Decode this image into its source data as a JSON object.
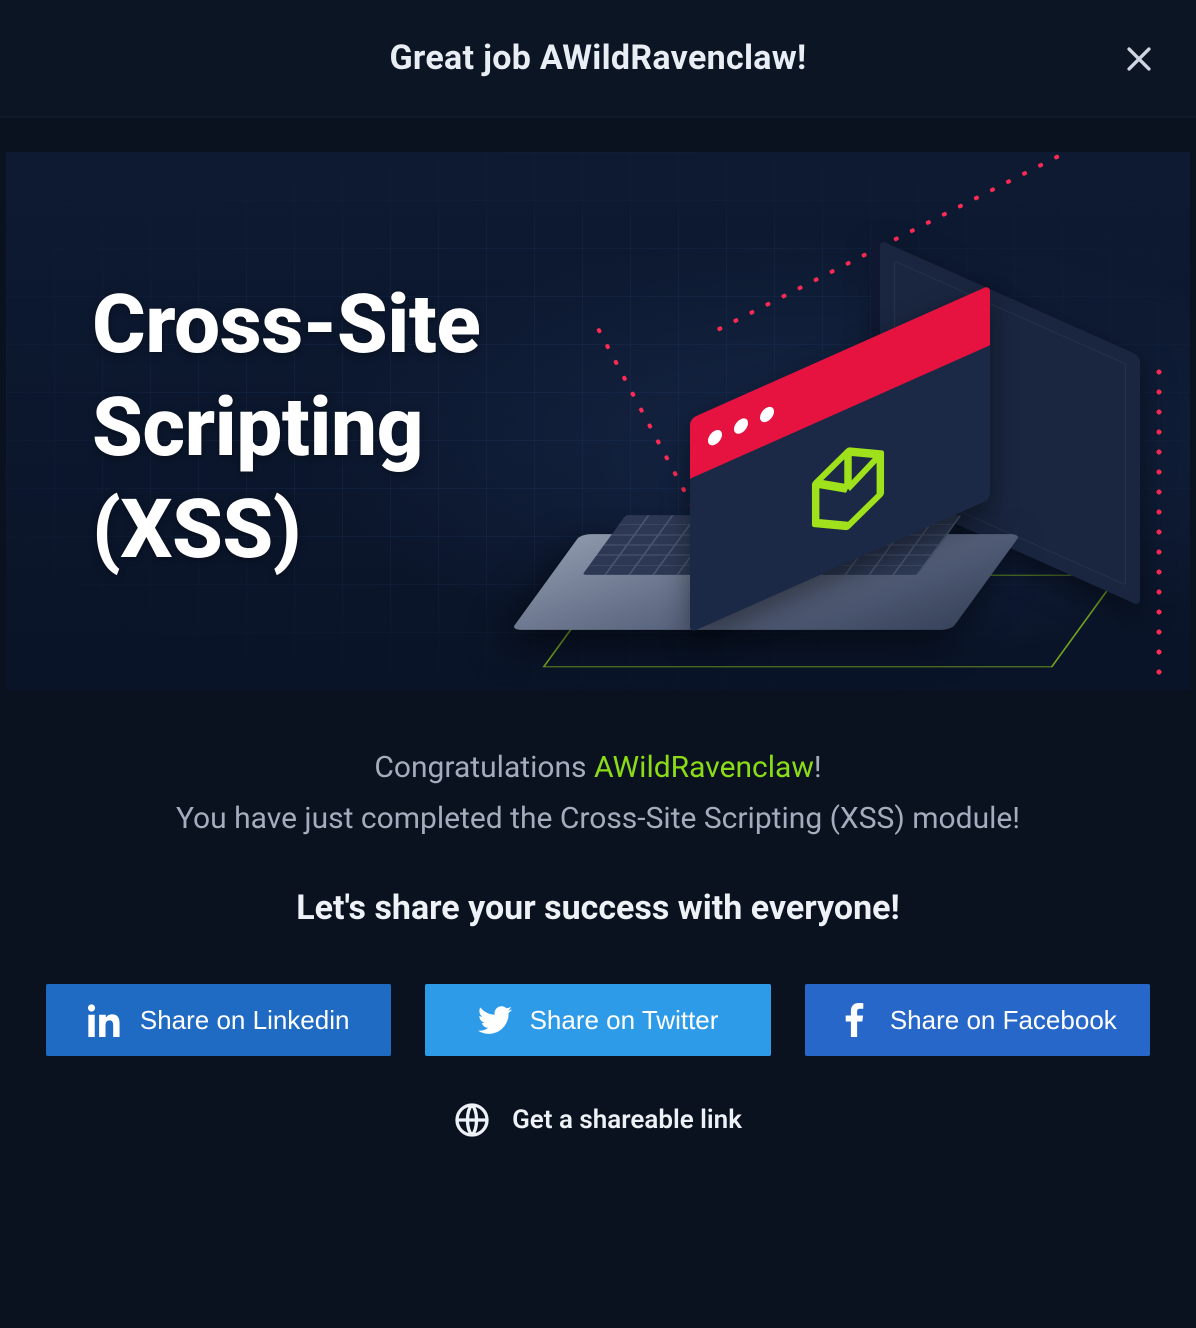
{
  "header": {
    "title": "Great job AWildRavenclaw!"
  },
  "banner": {
    "module_title": "Cross-Site\nScripting\n(XSS)"
  },
  "congrats": {
    "prefix": "Congratulations ",
    "username": "AWildRavenclaw",
    "suffix": "!",
    "completion_line": "You have just completed the Cross-Site Scripting (XSS) module!",
    "share_heading": "Let's share your success with everyone!"
  },
  "share": {
    "linkedin": "Share on Linkedin",
    "twitter": "Share on Twitter",
    "facebook": "Share on Facebook",
    "link": "Get a shareable link"
  },
  "colors": {
    "accent_green": "#8bdc16",
    "accent_red": "#e6123f"
  }
}
